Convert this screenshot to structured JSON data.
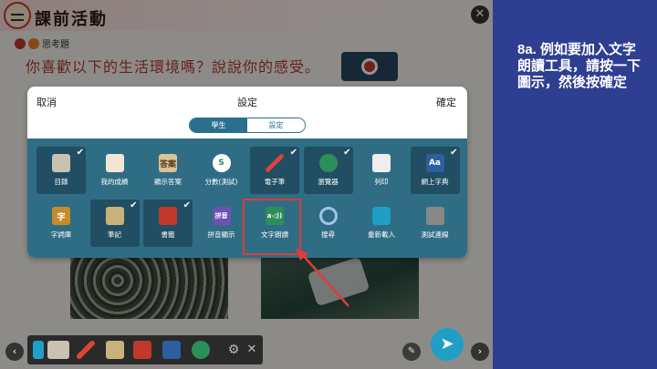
{
  "lesson": {
    "title": "課前活動",
    "badge": "思考題",
    "question": "你喜歡以下的生活環境嗎？說說你的感受。"
  },
  "dialog": {
    "cancel": "取消",
    "title": "設定",
    "confirm": "確定",
    "tabs": [
      {
        "label": "學生",
        "active": true
      },
      {
        "label": "設定",
        "active": false
      }
    ],
    "tools": [
      {
        "label": "目錄",
        "icon": "book-list-icon",
        "selected": true
      },
      {
        "label": "我的成績",
        "icon": "grades-chart-icon",
        "selected": false
      },
      {
        "label": "顯示答案",
        "icon": "answer-icon",
        "selected": false,
        "icon_text": "答案"
      },
      {
        "label": "分數(測試)",
        "icon": "score-s-icon",
        "selected": false,
        "icon_text": "S"
      },
      {
        "label": "電子筆",
        "icon": "pen-icon",
        "selected": true
      },
      {
        "label": "瀏覽器",
        "icon": "globe-icon",
        "selected": true
      },
      {
        "label": "列印",
        "icon": "printer-icon",
        "selected": false
      },
      {
        "label": "網上字典",
        "icon": "dictionary-icon",
        "selected": true,
        "icon_text": "Aa"
      },
      {
        "label": "字詞庫",
        "icon": "word-bank-icon",
        "selected": false,
        "icon_text": "字"
      },
      {
        "label": "筆記",
        "icon": "notes-icon",
        "selected": true
      },
      {
        "label": "書籤",
        "icon": "bookmark-icon",
        "selected": true
      },
      {
        "label": "拼音顯示",
        "icon": "pinyin-icon",
        "selected": false,
        "icon_text": "拼音"
      },
      {
        "label": "文字朗讀",
        "icon": "text-to-speech-icon",
        "selected": false,
        "icon_text": "a◁))"
      },
      {
        "label": "搜尋",
        "icon": "search-icon",
        "selected": false
      },
      {
        "label": "重新載入",
        "icon": "reload-icon",
        "selected": false
      },
      {
        "label": "測試連線",
        "icon": "signal-bars-icon",
        "selected": false
      }
    ]
  },
  "instruction": "8a. 例如要加入文字朗讀工具，請按一下圖示，然後按確定",
  "colors": {
    "panel": "#2f6d84",
    "selected_tile": "#214e63",
    "highlight": "#e03b3b",
    "sidebar": "#2e3f92",
    "question_text": "#b03a2e"
  }
}
